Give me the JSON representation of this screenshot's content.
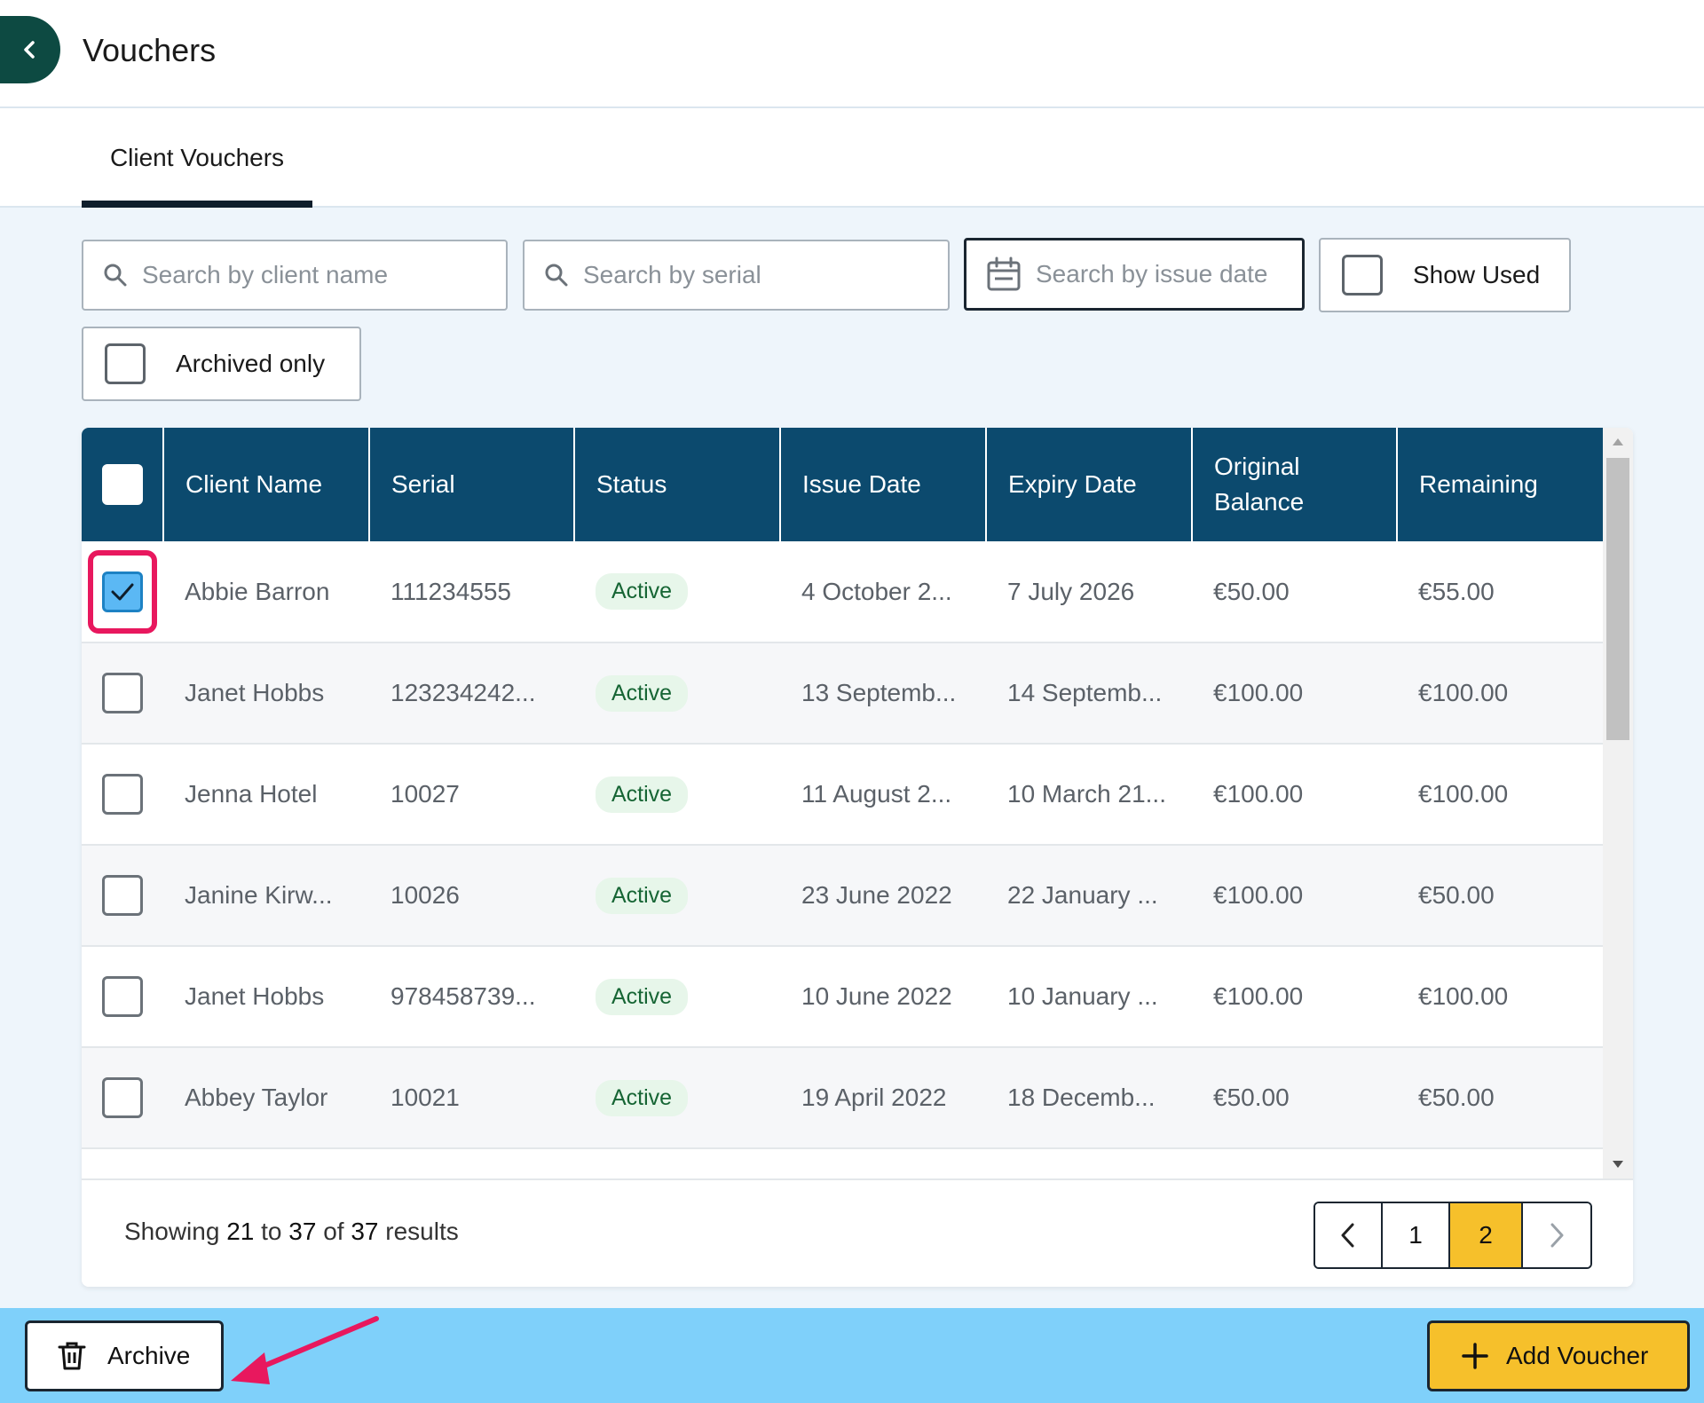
{
  "header": {
    "title": "Vouchers",
    "back_icon": "chevron-left-icon"
  },
  "tabs": [
    {
      "label": "Client Vouchers",
      "active": true
    }
  ],
  "filters": {
    "client_search_placeholder": "Search by client name",
    "serial_search_placeholder": "Search by serial",
    "issue_date_placeholder": "Search by issue date",
    "show_used_label": "Show Used",
    "archived_only_label": "Archived only"
  },
  "table": {
    "columns": [
      "Client Name",
      "Serial",
      "Status",
      "Issue Date",
      "Expiry Date",
      "Original Balance",
      "Remaining"
    ],
    "rows": [
      {
        "selected": true,
        "client": "Abbie Barron",
        "serial": "111234555",
        "status": "Active",
        "issue": "4 October 2...",
        "expiry": "7 July 2026",
        "original": "€50.00",
        "remaining": "€55.00"
      },
      {
        "selected": false,
        "client": "Janet Hobbs",
        "serial": "123234242...",
        "status": "Active",
        "issue": "13 Septemb...",
        "expiry": "14 Septemb...",
        "original": "€100.00",
        "remaining": "€100.00"
      },
      {
        "selected": false,
        "client": "Jenna Hotel",
        "serial": "10027",
        "status": "Active",
        "issue": "11 August 2...",
        "expiry": "10 March 21...",
        "original": "€100.00",
        "remaining": "€100.00"
      },
      {
        "selected": false,
        "client": "Janine Kirw...",
        "serial": "10026",
        "status": "Active",
        "issue": "23 June 2022",
        "expiry": "22 January ...",
        "original": "€100.00",
        "remaining": "€50.00"
      },
      {
        "selected": false,
        "client": "Janet Hobbs",
        "serial": "978458739...",
        "status": "Active",
        "issue": "10 June 2022",
        "expiry": "10 January ...",
        "original": "€100.00",
        "remaining": "€100.00"
      },
      {
        "selected": false,
        "client": "Abbey Taylor",
        "serial": "10021",
        "status": "Active",
        "issue": "19 April 2022",
        "expiry": "18 Decemb...",
        "original": "€50.00",
        "remaining": "€50.00"
      }
    ]
  },
  "pagination": {
    "showing_prefix": "Showing",
    "from": "21",
    "to_word": "to",
    "to": "37",
    "of_word": "of",
    "total": "37",
    "suffix": "results",
    "pages": [
      "1",
      "2"
    ],
    "current_page": "2"
  },
  "actions": {
    "archive_label": "Archive",
    "add_voucher_label": "Add Voucher"
  },
  "colors": {
    "header_bg": "#0c4a6e",
    "accent_yellow": "#f6c02b",
    "action_bar": "#7fd0fa",
    "status_green": "#166534",
    "highlight_pink": "#e8185e"
  }
}
